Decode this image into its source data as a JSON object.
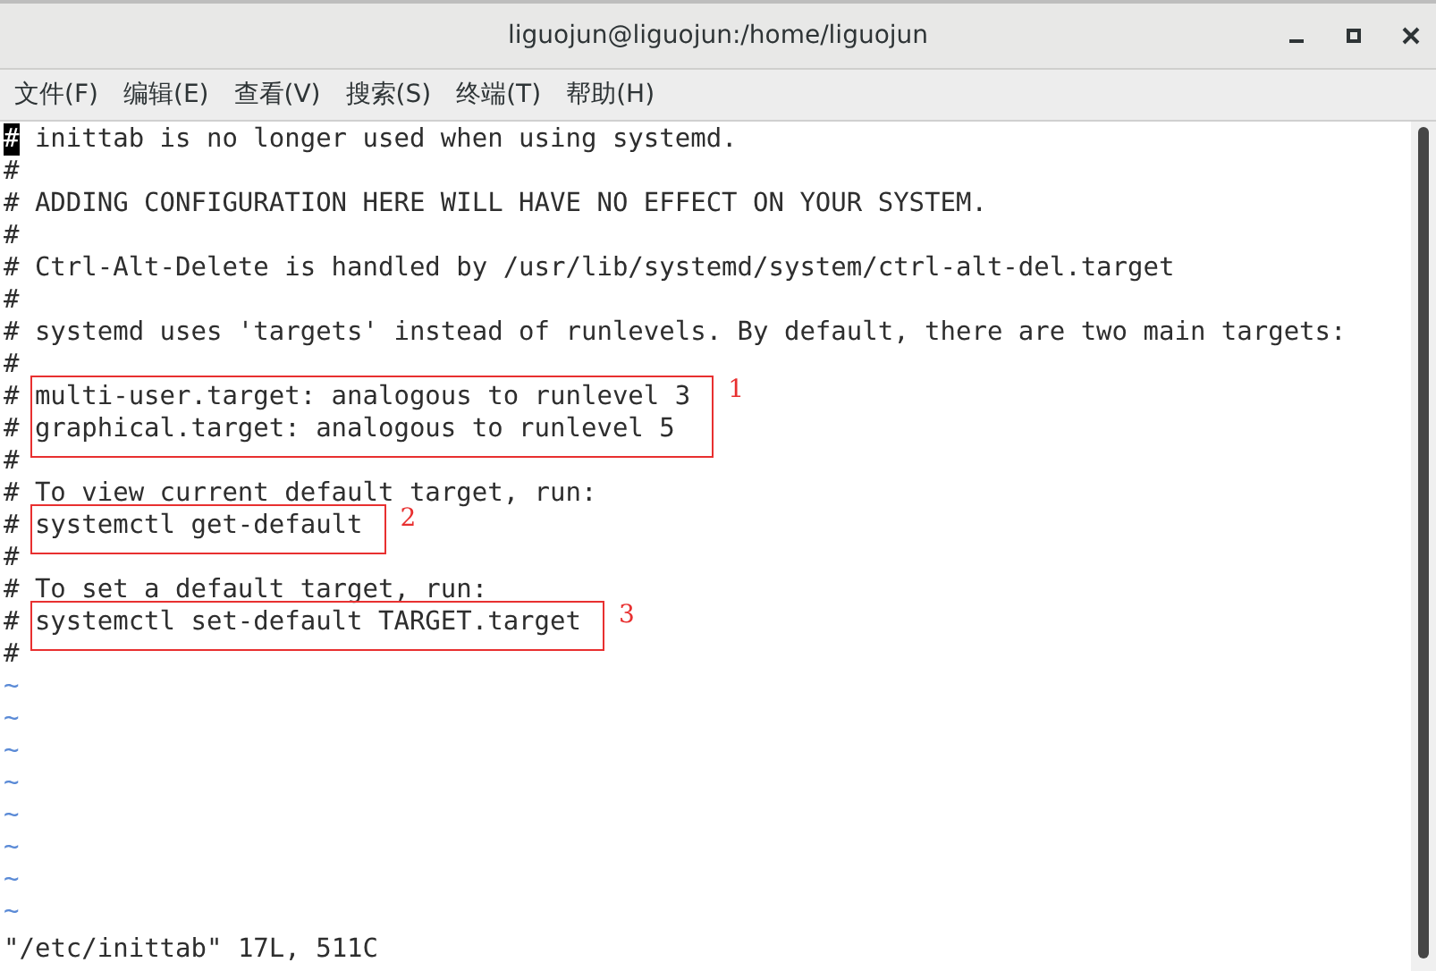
{
  "window": {
    "title": "liguojun@liguojun:/home/liguojun"
  },
  "menu": [
    {
      "label": "文件(F)"
    },
    {
      "label": "编辑(E)"
    },
    {
      "label": "查看(V)"
    },
    {
      "label": "搜索(S)"
    },
    {
      "label": "终端(T)"
    },
    {
      "label": "帮助(H)"
    }
  ],
  "editor": {
    "lines": [
      {
        "kind": "line",
        "prefix": "#",
        "cursor": true,
        "text": "inittab is no longer used when using systemd."
      },
      {
        "kind": "line",
        "prefix": "#",
        "cursor": false
      },
      {
        "kind": "line",
        "prefix": "#",
        "cursor": false,
        "text": "ADDING CONFIGURATION HERE WILL HAVE NO EFFECT ON YOUR SYSTEM."
      },
      {
        "kind": "line",
        "prefix": "#",
        "cursor": false
      },
      {
        "kind": "line",
        "prefix": "#",
        "cursor": false,
        "text": "Ctrl-Alt-Delete is handled by /usr/lib/systemd/system/ctrl-alt-del.target"
      },
      {
        "kind": "line",
        "prefix": "#",
        "cursor": false
      },
      {
        "kind": "line",
        "prefix": "#",
        "cursor": false,
        "text": "systemd uses 'targets' instead of runlevels. By default, there are two main targets:"
      },
      {
        "kind": "line",
        "prefix": "#",
        "cursor": false
      },
      {
        "kind": "boxed",
        "label": "1",
        "lines": [
          {
            "prefix": "#",
            "text": "multi-user.target: analogous to runlevel 3"
          },
          {
            "prefix": "#",
            "text": "graphical.target: analogous to runlevel 5"
          }
        ]
      },
      {
        "kind": "line",
        "prefix": "#",
        "cursor": false
      },
      {
        "kind": "line",
        "prefix": "#",
        "cursor": false,
        "text": "To view current default target, run:"
      },
      {
        "kind": "boxed",
        "label": "2",
        "lines": [
          {
            "prefix": "#",
            "text": "systemctl get-default"
          }
        ]
      },
      {
        "kind": "line",
        "prefix": "#",
        "cursor": false
      },
      {
        "kind": "line",
        "prefix": "#",
        "cursor": false,
        "text": "To set a default target, run:"
      },
      {
        "kind": "boxed",
        "label": "3",
        "lines": [
          {
            "prefix": "#",
            "text": "systemctl set-default TARGET.target"
          }
        ]
      },
      {
        "kind": "line",
        "prefix": "#",
        "cursor": false
      }
    ],
    "tildes": [
      "~",
      "~",
      "~",
      "~",
      "~",
      "~",
      "~",
      "~"
    ],
    "status": "\"/etc/inittab\" 17L, 511C"
  }
}
